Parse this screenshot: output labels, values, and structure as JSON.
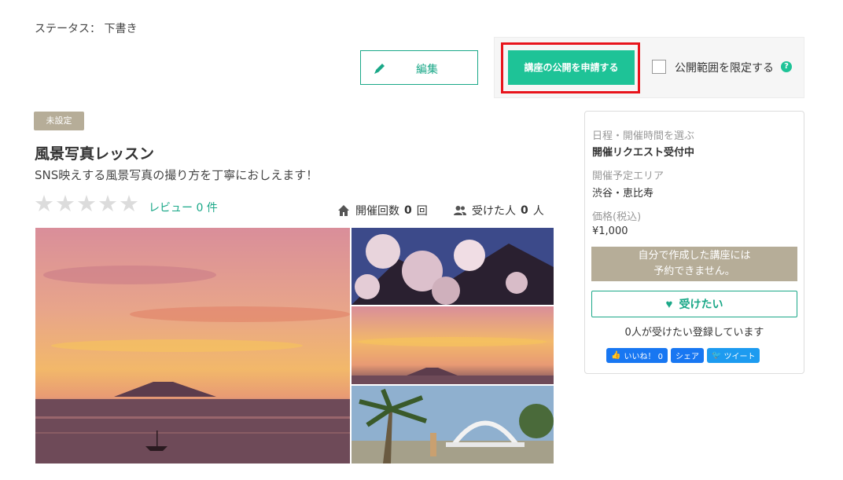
{
  "status": {
    "text": "ステータス： 下書き"
  },
  "toolbar": {
    "edit_label": "編集",
    "publish_label": "講座の公開を申請する",
    "limit_label": "公開範囲を限定する",
    "help_text": "?"
  },
  "course": {
    "badge": "未設定",
    "title": "風景写真レッスン",
    "subtitle": "SNS映えする風景写真の撮り方を丁寧におしえます！",
    "rating": 0,
    "rating_max": 5,
    "review_link": "レビュー 0 件",
    "held_label": "開催回数",
    "held_count": "0",
    "held_unit": "回",
    "attended_label": "受けた人",
    "attended_count": "0",
    "attended_unit": "人"
  },
  "side": {
    "schedule_label": "日程・開催時間を選ぶ",
    "schedule_value": "開催リクエスト受付中",
    "area_label": "開催予定エリア",
    "area_value": "渋谷・恵比寿",
    "price_label": "価格(税込)",
    "price_value": "¥1,000",
    "notice_line1": "自分で作成した講座には",
    "notice_line2": "予約できません。",
    "want_label": "受けたい",
    "want_count": "0人が受けたい登録しています",
    "like_label": "いいね！ 0",
    "share_label": "シェア",
    "tweet_label": "ツイート"
  },
  "colors": {
    "accent": "#1ec397",
    "link": "#1aa888",
    "highlight": "#e8141c",
    "badge": "#b6ad98",
    "facebook": "#1877f2",
    "twitter": "#1d9bf0"
  }
}
